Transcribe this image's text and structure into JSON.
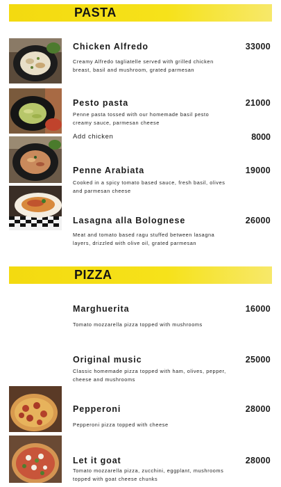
{
  "sections": [
    {
      "title": "PASTA",
      "items": [
        {
          "name": "Chicken Alfredo",
          "price": "33000",
          "description": "Creamy Alfredo tagliatelle served with grilled chicken breast, basil and mushroom, grated parmesan"
        },
        {
          "name": "Pesto pasta",
          "price": "21000",
          "description": "Penne pasta tossed with our homemade basil pesto creamy sauce, parmesan cheese",
          "addon": {
            "label": "Add chicken",
            "price": "8000"
          }
        },
        {
          "name": "Penne Arabiata",
          "price": "19000",
          "description": "Cooked in a spicy tomato based sauce, fresh basil, olives and parmesan cheese"
        },
        {
          "name": "Lasagna alla Bolognese",
          "price": "26000",
          "description": "Meat and tomato based ragu stuffed between lasagna layers, drizzled with olive oil, grated parmesan"
        }
      ]
    },
    {
      "title": "PIZZA",
      "items": [
        {
          "name": "Marghuerita",
          "price": "16000",
          "description": "Tomato mozzarella pizza topped with mushrooms"
        },
        {
          "name": "Original music",
          "price": "25000",
          "description": "Classic homemade pizza topped with ham, olives, pepper, cheese and mushrooms"
        },
        {
          "name": "Pepperoni",
          "price": "28000",
          "description": "Pepperoni pizza topped with cheese"
        },
        {
          "name": "Let it goat",
          "price": "28000",
          "description": "Tomato mozzarella pizza, zucchini, eggplant, mushrooms topped with goat cheese chunks"
        }
      ]
    }
  ],
  "colors": {
    "banner": "#f4dc12",
    "text": "#1b1b1b"
  }
}
